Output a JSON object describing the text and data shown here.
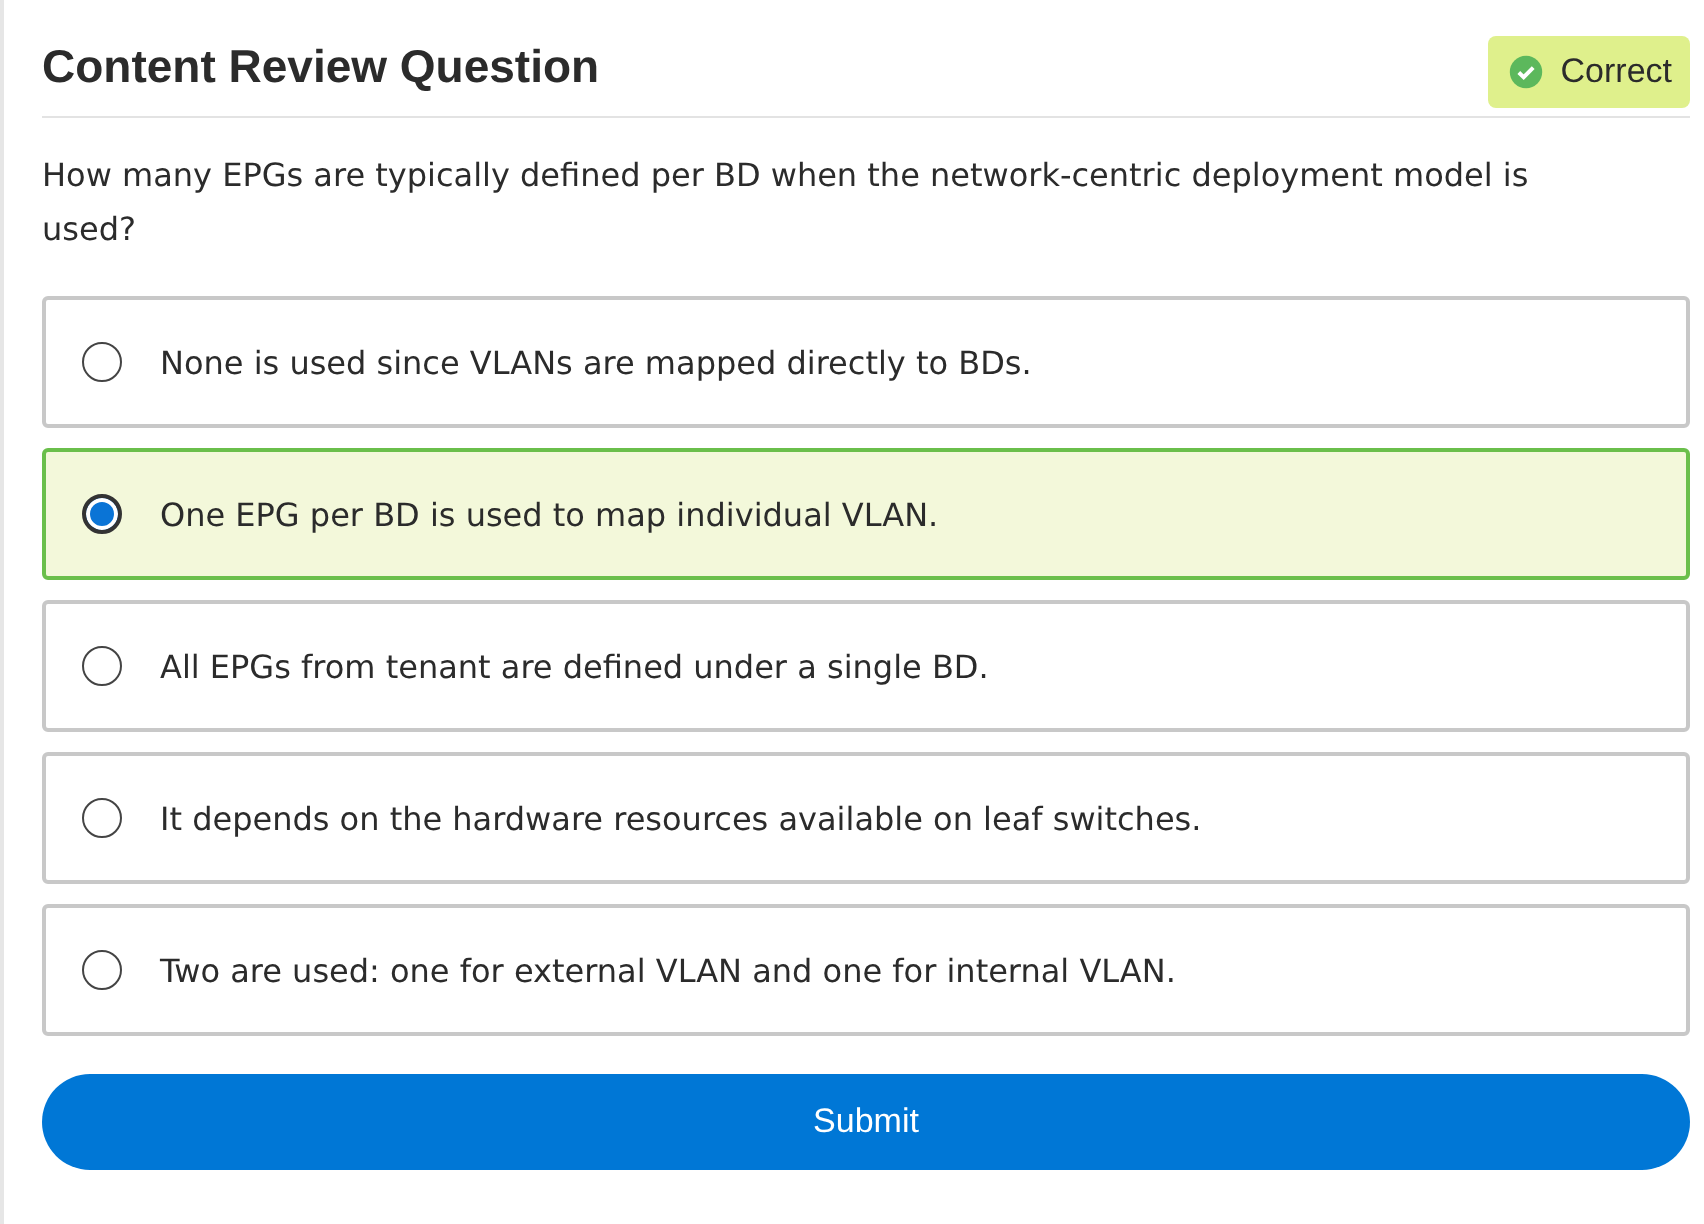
{
  "title": "Content Review Question",
  "result": {
    "label": "Correct",
    "kind": "correct"
  },
  "question": "How many EPGs are typically defined per BD when the network-centric deployment model is used?",
  "options": [
    {
      "label": "None is used since VLANs are mapped directly to BDs.",
      "selected": false
    },
    {
      "label": "One EPG per BD is used to map individual VLAN.",
      "selected": true
    },
    {
      "label": "All EPGs from tenant are defined under a single BD.",
      "selected": false
    },
    {
      "label": "It depends on the hardware resources available on leaf switches.",
      "selected": false
    },
    {
      "label": "Two are used: one for external VLAN and one for internal VLAN.",
      "selected": false
    }
  ],
  "submit": "Submit"
}
